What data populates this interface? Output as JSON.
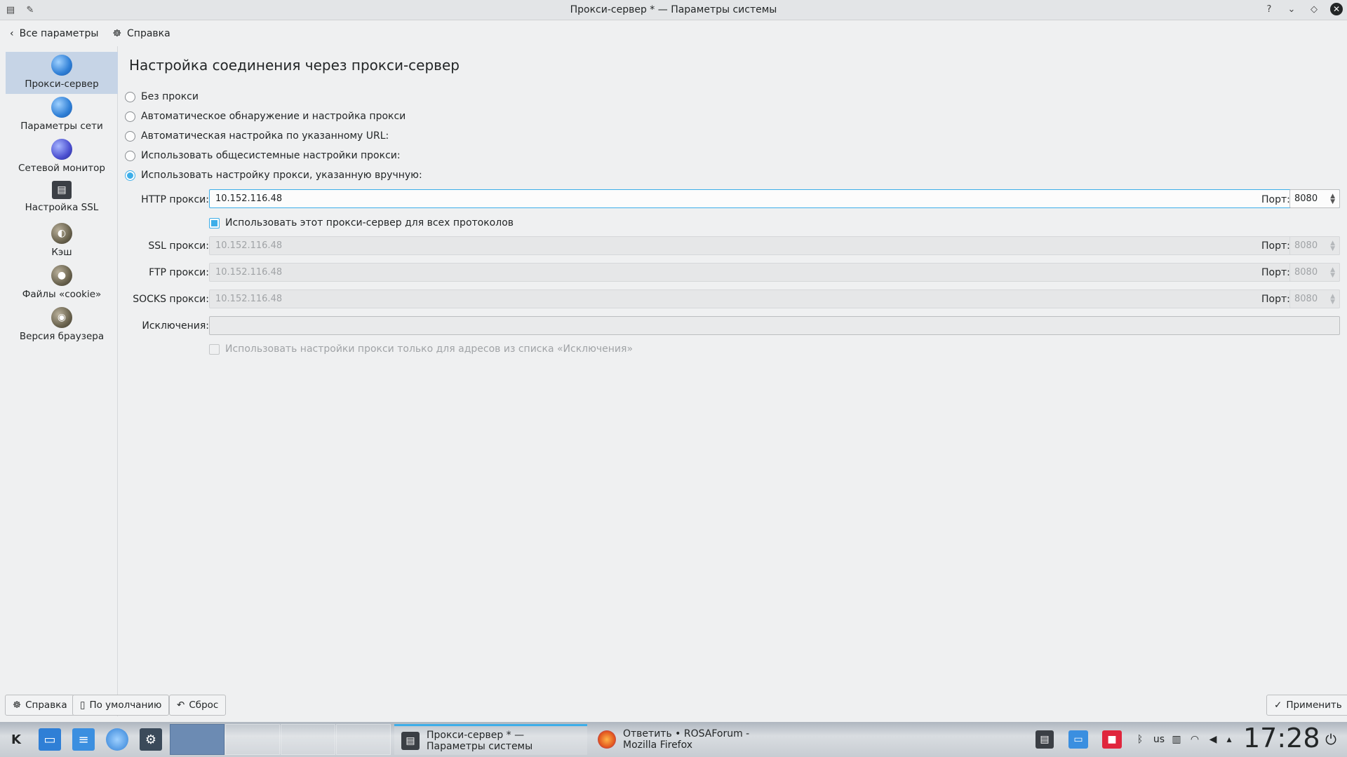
{
  "window": {
    "title": "Прокси-сервер * — Параметры системы"
  },
  "toolbar": {
    "back_label": "Все параметры",
    "help_label": "Справка"
  },
  "sidebar": {
    "items": [
      {
        "label": "Прокси-сервер",
        "icon": "globe-icon"
      },
      {
        "label": "Параметры сети",
        "icon": "globe-icon"
      },
      {
        "label": "Сетевой монитор",
        "icon": "network-monitor-icon"
      },
      {
        "label": "Настройка SSL",
        "icon": "ssl-icon"
      },
      {
        "label": "Кэш",
        "icon": "cache-icon"
      },
      {
        "label": "Файлы «cookie»",
        "icon": "cookie-icon"
      },
      {
        "label": "Версия браузера",
        "icon": "browser-version-icon"
      }
    ]
  },
  "main": {
    "title": "Настройка соединения через прокси-сервер",
    "options": [
      {
        "label": "Без прокси",
        "selected": false
      },
      {
        "label": "Автоматическое обнаружение и настройка прокси",
        "selected": false
      },
      {
        "label": "Автоматическая настройка по указанному URL:",
        "selected": false
      },
      {
        "label": "Использовать общесистемные настройки прокси:",
        "selected": false
      },
      {
        "label": "Использовать настройку прокси, указанную вручную:",
        "selected": true
      }
    ],
    "http": {
      "label": "HTTP прокси:",
      "value": "10.152.116.48",
      "port_label": "Порт:",
      "port": "8080"
    },
    "use_for_all": {
      "label": "Использовать этот прокси-сервер для всех протоколов",
      "checked": true
    },
    "ssl": {
      "label": "SSL прокси:",
      "value": "10.152.116.48",
      "port_label": "Порт:",
      "port": "8080"
    },
    "ftp": {
      "label": "FTP прокси:",
      "value": "10.152.116.48",
      "port_label": "Порт:",
      "port": "8080"
    },
    "socks": {
      "label": "SOCKS прокси:",
      "value": "10.152.116.48",
      "port_label": "Порт:",
      "port": "8080"
    },
    "exceptions": {
      "label": "Исключения:",
      "value": ""
    },
    "only_exceptions": {
      "label": "Использовать настройки прокси только для адресов из списка «Исключения»",
      "checked": false
    }
  },
  "buttons": {
    "help": "Справка",
    "defaults": "По умолчанию",
    "reset": "Сброс",
    "apply": "Применить"
  },
  "taskbar": {
    "tasks": [
      {
        "label": "Прокси-сервер * — Параметры системы"
      },
      {
        "label": "Ответить • ROSAForum - Mozilla Firefox"
      }
    ],
    "keyboard_layout": "us",
    "clock": "17:28"
  },
  "colors": {
    "accent": "#3daee9",
    "selected_item": "#c6d4e6"
  }
}
